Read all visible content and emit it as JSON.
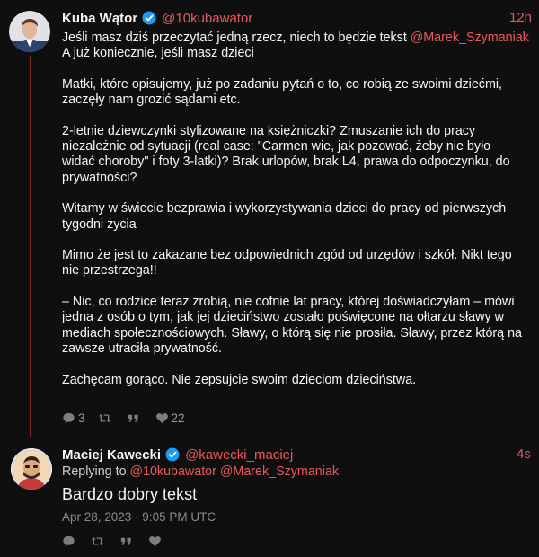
{
  "tweet": {
    "author_name": "Kuba Wątor",
    "author_handle": "@10kubawator",
    "time": "12h",
    "lines": [
      {
        "pre": "Jeśli masz dziś przeczytać jedną rzecz, niech to będzie tekst ",
        "mention": "@Marek_Szymaniak"
      },
      {
        "pre": "A już koniecznie, jeśli masz dzieci"
      },
      {
        "blank": true
      },
      {
        "pre": "Matki, które opisujemy, już po zadaniu pytań o to, co robią ze swoimi dziećmi,"
      },
      {
        "pre": "zaczęły nam grozić sądami etc."
      },
      {
        "blank": true
      },
      {
        "pre": "2-letnie dziewczynki stylizowane na księżniczki?    Zmuszanie ich do pracy"
      },
      {
        "pre": "niezależnie od sytuacji (real case: \"Carmen wie, jak pozować, żeby nie było"
      },
      {
        "pre": "widać choroby\" i foty 3-latki)? Brak urlopów, brak L4, prawa do odpoczynku, do"
      },
      {
        "pre": "prywatności?"
      },
      {
        "blank": true
      },
      {
        "pre": "Witamy w świecie bezprawia i wykorzystywania dzieci do pracy od pierwszych"
      },
      {
        "pre": "tygodni życia"
      },
      {
        "blank": true
      },
      {
        "pre": "Mimo że jest to zakazane bez odpowiednich zgód od urzędów i szkół. Nikt tego"
      },
      {
        "pre": "nie przestrzega!!"
      },
      {
        "blank": true
      },
      {
        "pre": "– Nic, co rodzice teraz zrobią, nie cofnie lat pracy, której doświadczyłam – mówi"
      },
      {
        "pre": "jedna z osób o tym, jak jej dzieciństwo zostało poświęcone na ołtarzu sławy w"
      },
      {
        "pre": "mediach społecznościowych. Sławy, o którą się nie prosiła. Sławy, przez którą na"
      },
      {
        "pre": "zawsze utraciła prywatność."
      },
      {
        "blank": true
      },
      {
        "pre": "Zachęcam gorąco. Nie zepsujcie swoim dzieciom dzieciństwa."
      }
    ],
    "stats": {
      "replies": "3",
      "retweets": "",
      "quotes": "",
      "likes": "22"
    }
  },
  "reply": {
    "author_name": "Maciej Kawecki",
    "author_handle": "@kawecki_maciej",
    "time": "4s",
    "replying_label": "Replying to",
    "replying_to": [
      "@10kubawator",
      "@Marek_Szymaniak"
    ],
    "text": "Bardzo dobry tekst",
    "date": "Apr 28, 2023 · 9:05 PM UTC",
    "stats": {
      "replies": "",
      "retweets": "",
      "quotes": "",
      "likes": ""
    }
  },
  "icons": [
    "comment-icon",
    "retweet-icon",
    "quote-icon",
    "heart-icon",
    "verified-icon"
  ],
  "colors": {
    "background": "#0f0f0f",
    "accent": "#e8595e",
    "text": "#f8f8f2",
    "muted": "#8a8a8a",
    "verified": "#1d9bf0"
  }
}
